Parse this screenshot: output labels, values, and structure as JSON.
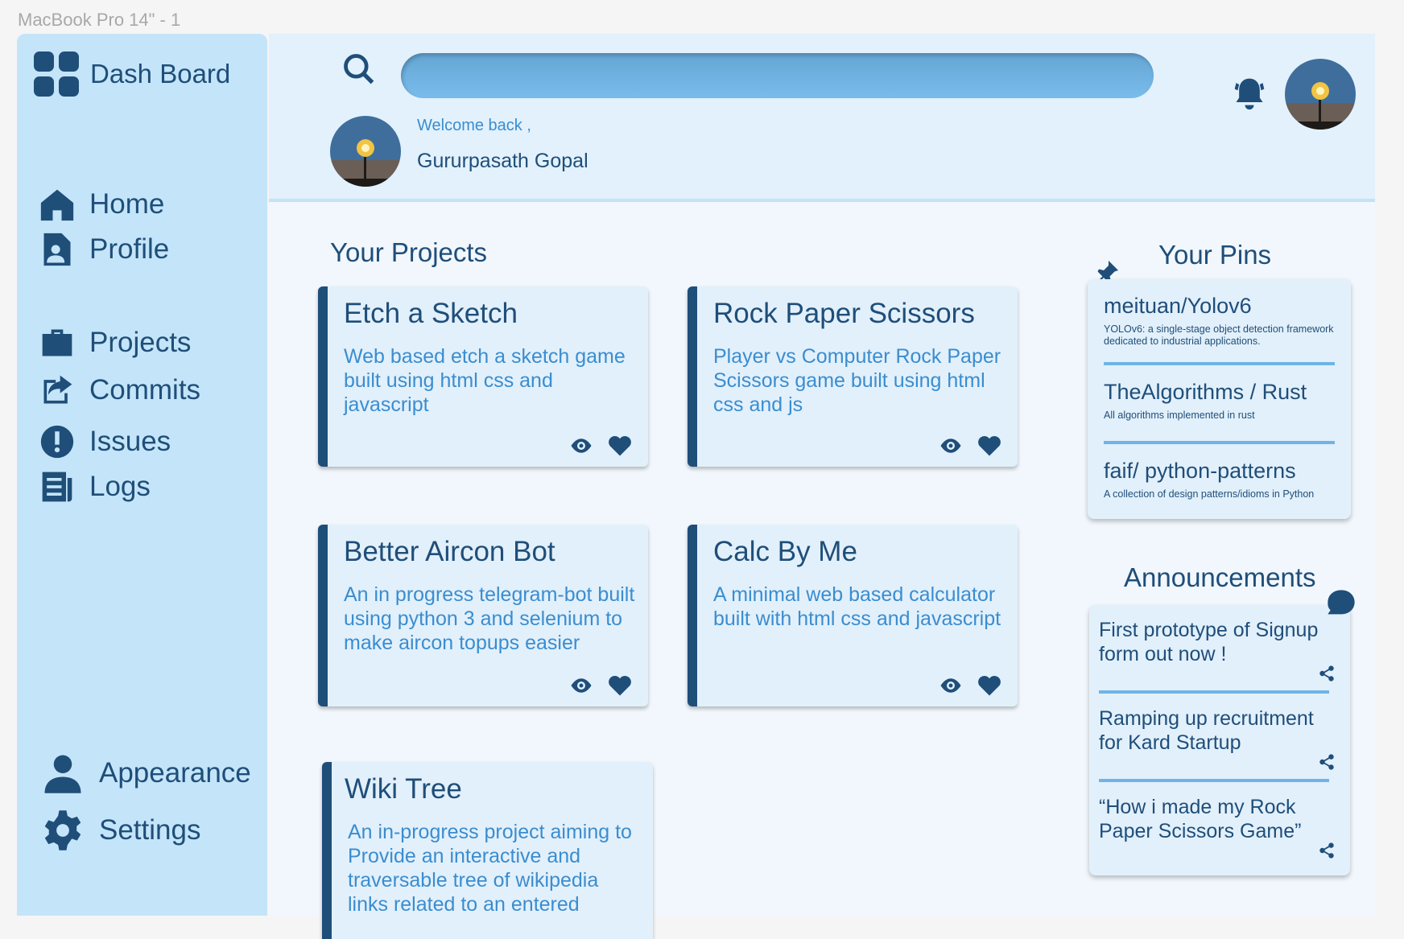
{
  "frame_label": "MacBook Pro 14\" - 1",
  "sidebar": {
    "brand": "Dash Board",
    "items": [
      {
        "label": "Home",
        "icon": "home-icon"
      },
      {
        "label": "Profile",
        "icon": "profile-icon"
      },
      {
        "label": "Projects",
        "icon": "briefcase-icon"
      },
      {
        "label": "Commits",
        "icon": "share-icon"
      },
      {
        "label": "Issues",
        "icon": "alert-icon"
      },
      {
        "label": "Logs",
        "icon": "logs-icon"
      },
      {
        "label": "Appearance",
        "icon": "user-icon"
      },
      {
        "label": "Settings",
        "icon": "gear-icon"
      }
    ]
  },
  "header": {
    "search_placeholder": "",
    "welcome": "Welcome back ,",
    "user_name": "Gururpasath Gopal"
  },
  "projects": {
    "title": "Your Projects",
    "cards": [
      {
        "title": "Etch a Sketch",
        "desc": "Web based etch a sketch game built using html css and javascript"
      },
      {
        "title": "Rock Paper Scissors",
        "desc": "Player vs Computer Rock Paper Scissors game built using html css and js"
      },
      {
        "title": "Better Aircon Bot",
        "desc": "An in progress telegram-bot built using python 3 and selenium to make aircon topups easier"
      },
      {
        "title": "Calc By Me",
        "desc": "A minimal web based calculator built with html css and javascript"
      },
      {
        "title": "Wiki Tree",
        "desc": "An in-progress project aiming to Provide an interactive and traversable tree of wikipedia links related to an entered"
      }
    ]
  },
  "pins": {
    "title": "Your Pins",
    "items": [
      {
        "name": "meituan/Yolov6",
        "desc": "YOLOv6: a single-stage object detection framework dedicated to industrial applications."
      },
      {
        "name": "TheAlgorithms / Rust",
        "desc": "All algorithms implemented in rust"
      },
      {
        "name": "faif/ python-patterns",
        "desc": "A collection of design patterns/idioms in Python"
      }
    ]
  },
  "announcements": {
    "title": "Announcements",
    "items": [
      "First prototype of Signup form out now !",
      "Ramping up recruitment for Kard Startup",
      "“How i made my Rock Paper Scissors Game”"
    ]
  },
  "colors": {
    "primary": "#1f4e79",
    "accent": "#3a8dd0",
    "sidebar": "#c4e5f9",
    "search": "#6fb4e6"
  }
}
